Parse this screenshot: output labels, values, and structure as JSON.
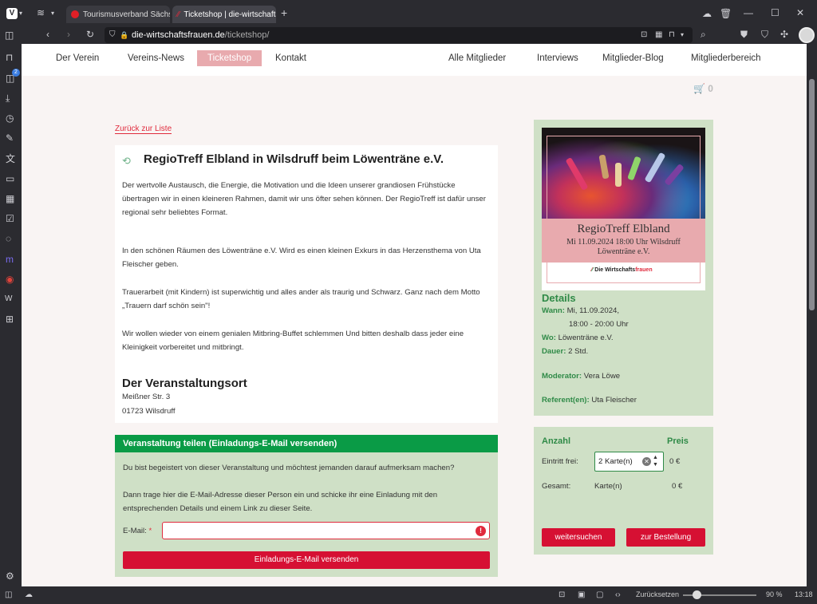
{
  "browser": {
    "tabs": [
      {
        "title": "Tourismusverband Sächsisc",
        "active": false
      },
      {
        "title": "Ticketshop | die-wirtschaftsi",
        "active": true
      }
    ],
    "new_tab": "+",
    "url_domain": "die-wirtschaftsfrauen.de",
    "url_path": "/ticketshop/",
    "sidebar_badge": "2",
    "status": {
      "reset": "Zurücksetzen",
      "zoom": "90 %",
      "time": "13:18"
    }
  },
  "nav": {
    "left": [
      "Der Verein",
      "Vereins-News",
      "Ticketshop",
      "Kontakt"
    ],
    "right": [
      "Alle Mitglieder",
      "Interviews",
      "Mitglieder-Blog",
      "Mitgliederbereich"
    ]
  },
  "cart_count": "0",
  "back_link": "Zurück zur Liste",
  "event": {
    "title": "RegioTreff Elbland in Wilsdruff beim Löwenträne e.V.",
    "paragraphs": [
      "Der wertvolle Austausch, die Energie, die Motivation und die Ideen unserer grandiosen Frühstücke übertragen wir in einen kleineren Rahmen, damit wir uns öfter sehen können. Der RegioTreff ist dafür unser regional sehr beliebtes Format.",
      "In den schönen Räumen des Löwenträne e.V. Wird es einen kleinen Exkurs in das Herzensthema von Uta Fleischer geben.",
      "Trauerarbeit (mit Kindern) ist superwichtig und alles ander als traurig und Schwarz. Ganz nach dem Motto „Trauern darf schön sein\"!",
      "Wir wollen wieder von einem genialen Mitbring-Buffet schlemmen Und bitten deshalb dass jeder eine Kleinigkeit vorbereitet und mitbringt."
    ],
    "venue_heading": "Der Veranstaltungsort",
    "street": "Meißner Str. 3",
    "city": "01723 Wilsdruff"
  },
  "share": {
    "heading": "Veranstaltung teilen (Einladungs-E-Mail versenden)",
    "text1": "Du bist begeistert von dieser Veranstaltung und möchtest jemanden darauf aufmerksam machen?",
    "text2": "Dann trage hier die E-Mail-Adresse dieser Person ein und schicke ihr eine Einladung mit den entsprechenden Details und einem Link zu dieser Seite.",
    "email_label": "E-Mail:",
    "required_mark": "*",
    "email_value": "",
    "error_mark": "!",
    "send_button": "Einladungs-E-Mail versenden"
  },
  "poster": {
    "title": "RegioTreff Elbland",
    "line2": "Mi 11.09.2024 18:00 Uhr Wilsdruff",
    "line3": "Löwenträne e.V.",
    "logo_text": "Die Wirtschafts",
    "logo_accent": "frauen"
  },
  "details": {
    "heading": "Details",
    "when_label": "Wann:",
    "when_date": "Mi, 11.09.2024,",
    "when_time": "18:00 - 20:00 Uhr",
    "where_label": "Wo:",
    "where": "Löwenträne e.V.",
    "duration_label": "Dauer:",
    "duration": "2 Std.",
    "moderator_label": "Moderator:",
    "moderator": "Vera Löwe",
    "speaker_label": "Referent(en):",
    "speaker": "Uta Fleischer"
  },
  "order": {
    "qty_header": "Anzahl",
    "price_header": "Preis",
    "ticket_label": "Eintritt frei:",
    "qty_value": "2",
    "qty_unit": "Karte(n)",
    "price": "0 €",
    "total_label": "Gesamt:",
    "total_unit": "Karte(n)",
    "total_price": "0 €",
    "continue_button": "weitersuchen",
    "checkout_button": "zur Bestellung"
  }
}
